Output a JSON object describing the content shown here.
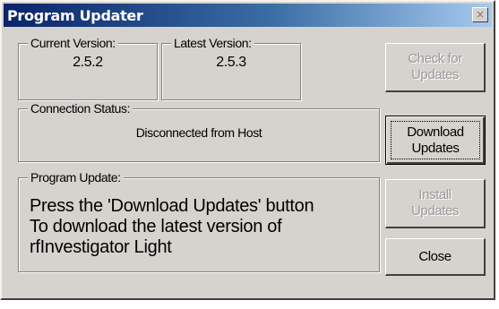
{
  "window": {
    "title": "Program Updater",
    "close_glyph": "×"
  },
  "versions": {
    "current_label": "Current Version:",
    "current_value": "2.5.2",
    "latest_label": "Latest Version:",
    "latest_value": "2.5.3"
  },
  "connection": {
    "label": "Connection Status:",
    "value": "Disconnected from Host"
  },
  "update": {
    "label": "Program Update:",
    "lines": [
      "Press the 'Download Updates' button",
      "To download the latest version of",
      "rfInvestigator Light"
    ]
  },
  "buttons": {
    "check": {
      "label": "Check for\nUpdates",
      "enabled": false
    },
    "download": {
      "label": "Download\nUpdates",
      "enabled": true,
      "focused": true
    },
    "install": {
      "label": "Install\nUpdates",
      "enabled": false
    },
    "close": {
      "label": "Close",
      "enabled": true
    }
  },
  "colors": {
    "face": "#d6d3ce",
    "title_start": "#0a246a",
    "title_end": "#a6caf0",
    "disabled_text": "#9a9a9a"
  }
}
